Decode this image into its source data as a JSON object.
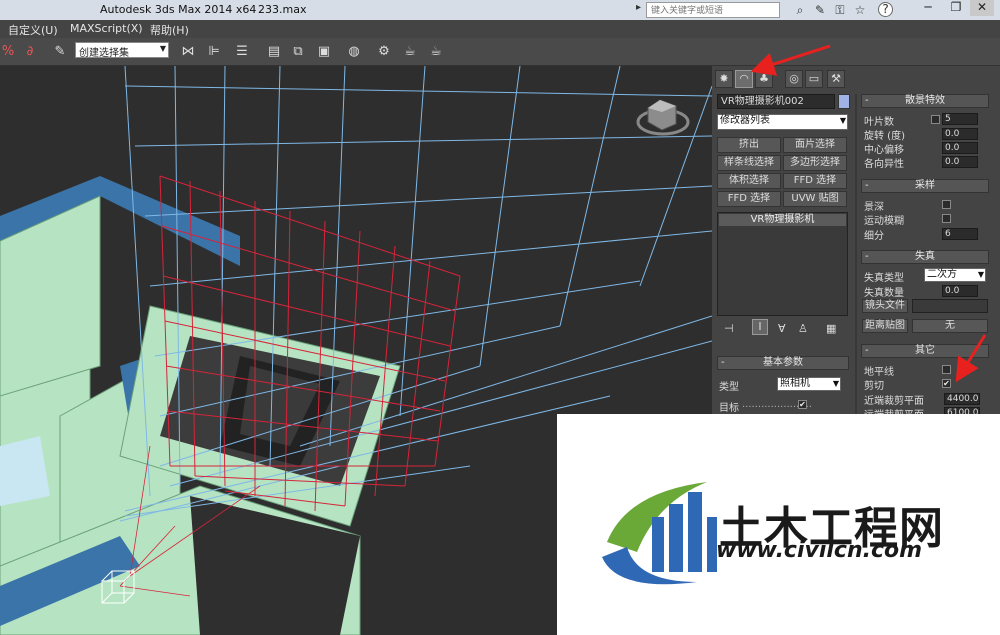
{
  "titlebar": {
    "app_title": "Autodesk 3ds Max  2014 x64",
    "file_name": "233.max",
    "search_placeholder": "键入关键字或短语",
    "icons": [
      "binoculars-icon",
      "tools-icon",
      "key-icon",
      "star-icon",
      "help-icon"
    ],
    "help_label": "?"
  },
  "menubar": {
    "items": [
      "自定义(U)",
      "MAXScript(X)",
      "帮助(H)"
    ]
  },
  "toolbar": {
    "selection_set": "创建选择集"
  },
  "command_panel": {
    "object_name": "VR物理摄影机002",
    "modifier_list": "修改器列表",
    "modifier_buttons": [
      "挤出",
      "面片选择",
      "样条线选择",
      "多边形选择",
      "体积选择",
      "FFD 选择",
      "FFD 选择",
      "UVW 贴图"
    ],
    "stack_item": "VR物理摄影机",
    "basic_params": {
      "title": "基本参数",
      "type_label": "类型",
      "type_value": "照相机",
      "target_label": "目标",
      "target_checked": true
    },
    "bokeh": {
      "title": "散景特效",
      "rows": [
        {
          "label": "叶片数",
          "has_check": true,
          "value": "5"
        },
        {
          "label": "旋转 (度)",
          "has_check": false,
          "value": "0.0"
        },
        {
          "label": "中心偏移",
          "has_check": false,
          "value": "0.0"
        },
        {
          "label": "各向异性",
          "has_check": false,
          "value": "0.0"
        }
      ]
    },
    "sampling": {
      "title": "采样",
      "dof_label": "景深",
      "motion_blur_label": "运动模糊",
      "subdivs_label": "细分",
      "subdivs_value": "6"
    },
    "distortion": {
      "title": "失真",
      "type_label": "失真类型",
      "type_value": "二次方",
      "amount_label": "失真数量",
      "amount_value": "0.0",
      "lens_file_label": "镜头文件",
      "map_label": "距离贴图",
      "map_value": "无"
    },
    "misc": {
      "title": "其它",
      "horizon_label": "地平线",
      "clipping_label": "剪切",
      "clipping_checked": true,
      "near_clip_label": "近端裁剪平面",
      "near_clip_value": "4400.0",
      "far_clip_label": "远端裁剪平面",
      "far_clip_value": "6100.0"
    }
  },
  "watermark": {
    "text_cn": "土木工程网",
    "url": "www.civilcn.com"
  },
  "colors": {
    "wire_blue": "#7fb8e6",
    "wire_red": "#d6243a",
    "wall_green": "#b8e8c4",
    "beam_blue": "#3a74a8",
    "arrow_red": "#e8211f"
  }
}
